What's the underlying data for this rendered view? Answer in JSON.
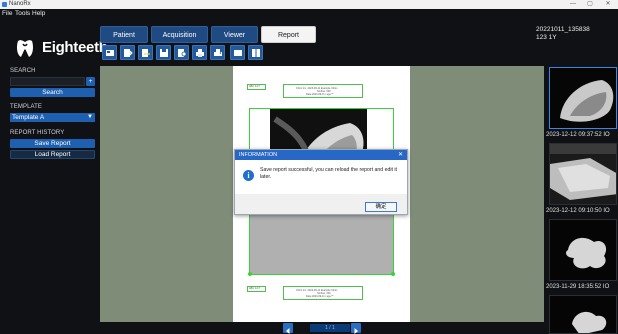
{
  "window": {
    "title": "NanoRx",
    "controls": [
      "—",
      "▢",
      "✕"
    ]
  },
  "menu": [
    "File",
    "Tools",
    "Help"
  ],
  "brand": {
    "name": "Eighteeth"
  },
  "tabs": [
    {
      "label": "Patient",
      "active": false
    },
    {
      "label": "Acquisition",
      "active": false
    },
    {
      "label": "Viewer",
      "active": false
    },
    {
      "label": "Report",
      "active": true
    }
  ],
  "patient": {
    "id": "20221011_135838",
    "info": "123 1Y"
  },
  "toolbar": {
    "icons": [
      "template-icon",
      "export-icon",
      "export-alt-icon",
      "save-icon",
      "share-icon",
      "print-icon",
      "print-alt-icon",
      "single-layout-icon",
      "double-layout-icon"
    ]
  },
  "sidebar": {
    "search_title": "SEARCH",
    "search_add": "+",
    "search_button": "Search",
    "template_title": "TEMPLATE",
    "template_value": "Template A",
    "history_title": "REPORT HISTORY",
    "save_report": "Save Report",
    "load_report": "Load Report"
  },
  "report": {
    "header_lines": [
      "Clinic Inc. 2023-09-11  Example Clinic",
      "Tel/Fax: 000",
      "Date:2023-09-11 / age:**"
    ],
    "footer_lines": [
      "Clinic Inc. 2023-09-11  Example Clinic",
      "Tel/Fax: 000",
      "Date:2023-09-11 / age:**"
    ],
    "label_small": "ABC 0-47"
  },
  "dialog": {
    "title": "INFORMATION",
    "close": "✕",
    "message": "Save report successful, you can reload the report and edit it later.",
    "ok": "确定"
  },
  "pagenav": {
    "page": "1 / 1"
  },
  "thumbnails": [
    {
      "timestamp": "2023-12-12 09:37:52  IO"
    },
    {
      "timestamp": "2023-12-12 09:10:50  IO"
    },
    {
      "timestamp": "2023-11-29 18:35:52  IO"
    }
  ],
  "colors": {
    "accent": "#1e5fb0",
    "tab": "#1f4a82",
    "viewer_bg": "#7f8c77",
    "frame": "#3bd13b",
    "dialog_title": "#2767c6"
  }
}
